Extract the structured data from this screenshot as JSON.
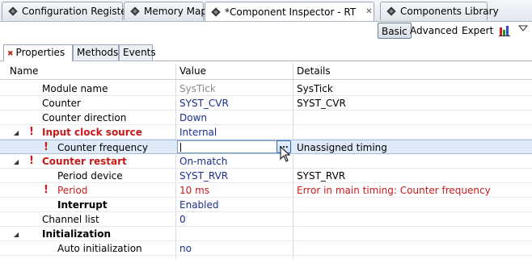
{
  "editor_tabs": [
    {
      "label": "Configuration Registers",
      "close": ""
    },
    {
      "label": "Memory Map",
      "close": ""
    },
    {
      "label": "*Component Inspector - RT",
      "close": "✕"
    },
    {
      "label": "Components Library",
      "close": ""
    }
  ],
  "toolbar": {
    "basic": "Basic",
    "advanced": "Advanced",
    "expert": "Expert"
  },
  "subtabs": {
    "properties": "Properties",
    "methods": "Methods",
    "events": "Events"
  },
  "columns": {
    "name": "Name",
    "value": "Value",
    "details": "Details"
  },
  "rows": [
    {
      "name": "Module name",
      "value": "SysTick",
      "details": "SysTick"
    },
    {
      "name": "Counter",
      "value": "SYST_CVR",
      "details": "SYST_CVR"
    },
    {
      "name": "Counter direction",
      "value": "Down",
      "details": ""
    },
    {
      "name": "Input clock source",
      "value": "Internal",
      "details": ""
    },
    {
      "name": "Counter frequency",
      "value": "",
      "details": "Unassigned timing",
      "button": "..."
    },
    {
      "name": "Counter restart",
      "value": "On-match",
      "details": ""
    },
    {
      "name": "Period device",
      "value": "SYST_RVR",
      "details": "SYST_RVR"
    },
    {
      "name": "Period",
      "value": "10 ms",
      "details": "Error in main timing: Counter frequency"
    },
    {
      "name": "Interrupt",
      "value": "Enabled",
      "details": ""
    },
    {
      "name": "Channel list",
      "value": "0",
      "details": ""
    },
    {
      "name": "Initialization",
      "value": "",
      "details": ""
    },
    {
      "name": "Auto initialization",
      "value": "no",
      "details": ""
    }
  ],
  "icons": {
    "tab_icon": "chip-icon",
    "chart": "bar-chart-icon",
    "menu": "view-menu-icon",
    "error": "error-icon",
    "expand": "expand-triangle-icon"
  },
  "colors": {
    "error": "#c81a1a",
    "value": "#1a2f8c",
    "selection": "#dfe9f7"
  }
}
